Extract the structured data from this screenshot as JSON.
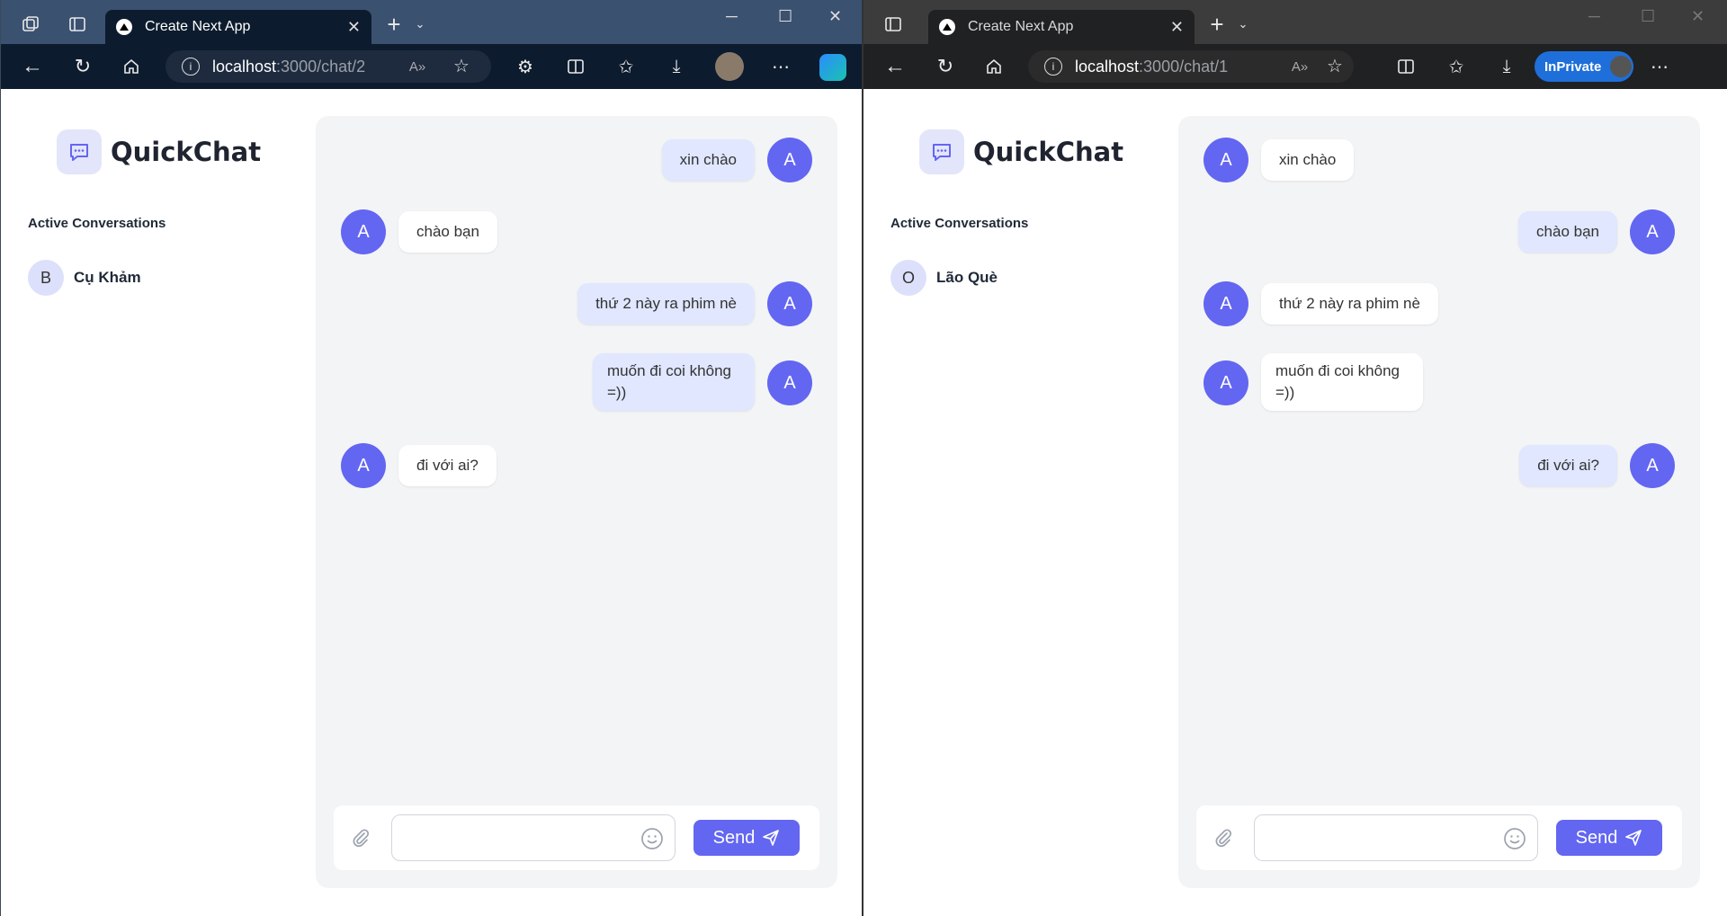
{
  "windows": [
    {
      "tab_title": "Create Next App",
      "url_host": "localhost",
      "url_path": ":3000/chat/2",
      "inprivate_label": "",
      "brand": "QuickChat",
      "section_title": "Active Conversations",
      "conversation": {
        "initial": "B",
        "name": "Cụ Khảm"
      },
      "messages": [
        {
          "text": "xin chào",
          "sender": "me",
          "avatar": "A"
        },
        {
          "text": "chào bạn",
          "sender": "them",
          "avatar": "A"
        },
        {
          "text": "thứ 2 này ra phim nè",
          "sender": "me",
          "avatar": "A"
        },
        {
          "text": "muốn đi coi không =))",
          "sender": "me",
          "avatar": "A"
        },
        {
          "text": "đi với ai?",
          "sender": "them",
          "avatar": "A"
        }
      ],
      "input_value": "",
      "send_label": "Send"
    },
    {
      "tab_title": "Create Next App",
      "url_host": "localhost",
      "url_path": ":3000/chat/1",
      "inprivate_label": "InPrivate",
      "brand": "QuickChat",
      "section_title": "Active Conversations",
      "conversation": {
        "initial": "O",
        "name": "Lão Què"
      },
      "messages": [
        {
          "text": "xin chào",
          "sender": "them",
          "avatar": "A"
        },
        {
          "text": "chào bạn",
          "sender": "me",
          "avatar": "A"
        },
        {
          "text": "thứ 2 này ra phim nè",
          "sender": "them",
          "avatar": "A"
        },
        {
          "text": "muốn đi coi không =))",
          "sender": "them",
          "avatar": "A"
        },
        {
          "text": "đi với ai?",
          "sender": "me",
          "avatar": "A"
        }
      ],
      "input_value": "",
      "send_label": "Send"
    }
  ],
  "colors": {
    "accent": "#6366f1",
    "bubble_me": "#e0e7ff",
    "bubble_them": "#ffffff",
    "chat_bg": "#f3f4f6"
  },
  "icons": [
    "workspaces-icon",
    "tab-actions-icon",
    "new-tab-icon",
    "back-icon",
    "refresh-icon",
    "home-icon",
    "info-icon",
    "read-aloud-icon",
    "favorite-icon",
    "extensions-icon",
    "split-screen-icon",
    "favorites-icon",
    "download-icon",
    "more-icon",
    "copilot-icon",
    "chat-logo-icon",
    "attach-icon",
    "emoji-icon",
    "send-icon"
  ]
}
